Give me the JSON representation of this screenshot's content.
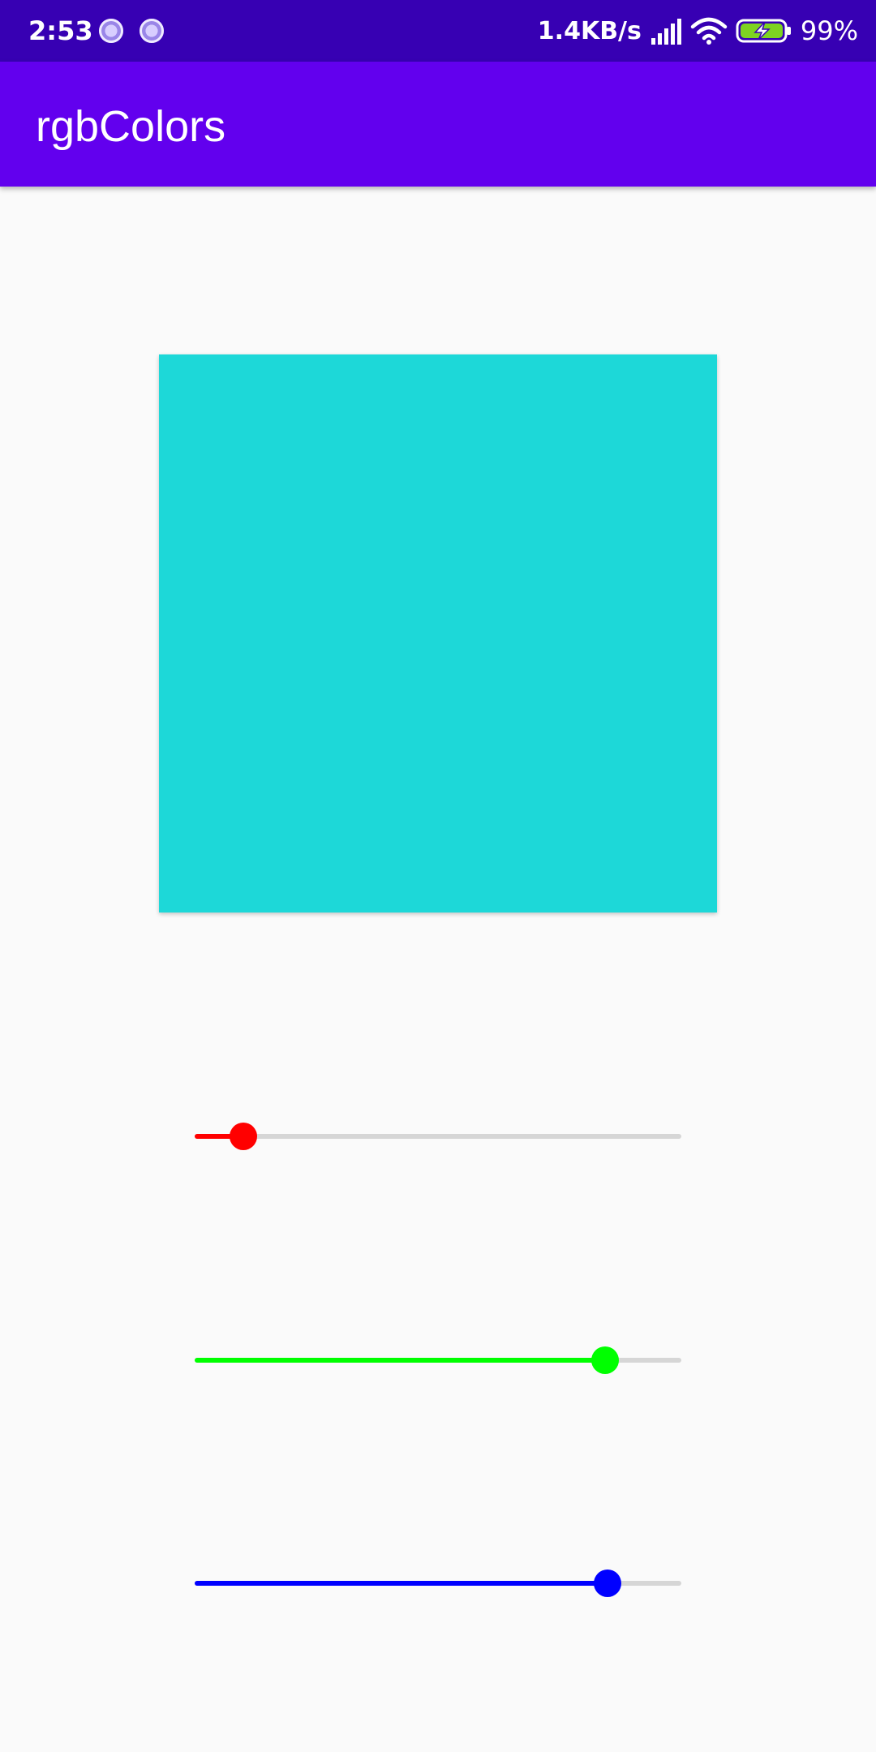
{
  "status_bar": {
    "time": "2:53",
    "net_speed": "1.4KB/s",
    "battery_percent": "99%",
    "icons": [
      "notification-icon",
      "notification-icon",
      "signal-icon",
      "wifi-icon",
      "battery-charging-icon"
    ]
  },
  "app_bar": {
    "title": "rgbColors",
    "color": "#6200ee"
  },
  "preview": {
    "color": "#1dd8d8"
  },
  "sliders": [
    {
      "name": "red",
      "color": "#ff0000",
      "value_fraction": 0.1
    },
    {
      "name": "green",
      "color": "#00ff00",
      "value_fraction": 0.843
    },
    {
      "name": "blue",
      "color": "#0000ff",
      "value_fraction": 0.848
    }
  ]
}
